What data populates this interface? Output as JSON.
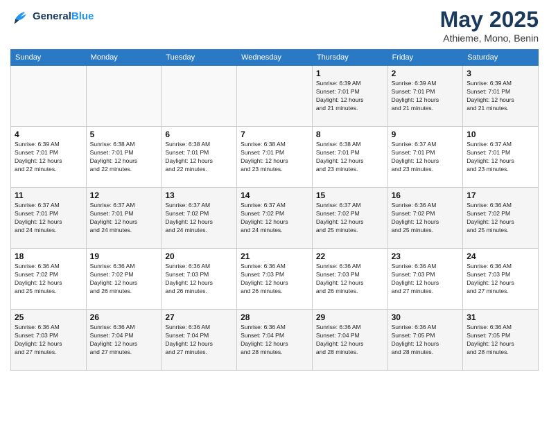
{
  "logo": {
    "line1": "General",
    "line2": "Blue"
  },
  "title": "May 2025",
  "location": "Athieme, Mono, Benin",
  "weekdays": [
    "Sunday",
    "Monday",
    "Tuesday",
    "Wednesday",
    "Thursday",
    "Friday",
    "Saturday"
  ],
  "weeks": [
    [
      {
        "day": "",
        "info": ""
      },
      {
        "day": "",
        "info": ""
      },
      {
        "day": "",
        "info": ""
      },
      {
        "day": "",
        "info": ""
      },
      {
        "day": "1",
        "info": "Sunrise: 6:39 AM\nSunset: 7:01 PM\nDaylight: 12 hours\nand 21 minutes."
      },
      {
        "day": "2",
        "info": "Sunrise: 6:39 AM\nSunset: 7:01 PM\nDaylight: 12 hours\nand 21 minutes."
      },
      {
        "day": "3",
        "info": "Sunrise: 6:39 AM\nSunset: 7:01 PM\nDaylight: 12 hours\nand 21 minutes."
      }
    ],
    [
      {
        "day": "4",
        "info": "Sunrise: 6:39 AM\nSunset: 7:01 PM\nDaylight: 12 hours\nand 22 minutes."
      },
      {
        "day": "5",
        "info": "Sunrise: 6:38 AM\nSunset: 7:01 PM\nDaylight: 12 hours\nand 22 minutes."
      },
      {
        "day": "6",
        "info": "Sunrise: 6:38 AM\nSunset: 7:01 PM\nDaylight: 12 hours\nand 22 minutes."
      },
      {
        "day": "7",
        "info": "Sunrise: 6:38 AM\nSunset: 7:01 PM\nDaylight: 12 hours\nand 23 minutes."
      },
      {
        "day": "8",
        "info": "Sunrise: 6:38 AM\nSunset: 7:01 PM\nDaylight: 12 hours\nand 23 minutes."
      },
      {
        "day": "9",
        "info": "Sunrise: 6:37 AM\nSunset: 7:01 PM\nDaylight: 12 hours\nand 23 minutes."
      },
      {
        "day": "10",
        "info": "Sunrise: 6:37 AM\nSunset: 7:01 PM\nDaylight: 12 hours\nand 23 minutes."
      }
    ],
    [
      {
        "day": "11",
        "info": "Sunrise: 6:37 AM\nSunset: 7:01 PM\nDaylight: 12 hours\nand 24 minutes."
      },
      {
        "day": "12",
        "info": "Sunrise: 6:37 AM\nSunset: 7:01 PM\nDaylight: 12 hours\nand 24 minutes."
      },
      {
        "day": "13",
        "info": "Sunrise: 6:37 AM\nSunset: 7:02 PM\nDaylight: 12 hours\nand 24 minutes."
      },
      {
        "day": "14",
        "info": "Sunrise: 6:37 AM\nSunset: 7:02 PM\nDaylight: 12 hours\nand 24 minutes."
      },
      {
        "day": "15",
        "info": "Sunrise: 6:37 AM\nSunset: 7:02 PM\nDaylight: 12 hours\nand 25 minutes."
      },
      {
        "day": "16",
        "info": "Sunrise: 6:36 AM\nSunset: 7:02 PM\nDaylight: 12 hours\nand 25 minutes."
      },
      {
        "day": "17",
        "info": "Sunrise: 6:36 AM\nSunset: 7:02 PM\nDaylight: 12 hours\nand 25 minutes."
      }
    ],
    [
      {
        "day": "18",
        "info": "Sunrise: 6:36 AM\nSunset: 7:02 PM\nDaylight: 12 hours\nand 25 minutes."
      },
      {
        "day": "19",
        "info": "Sunrise: 6:36 AM\nSunset: 7:02 PM\nDaylight: 12 hours\nand 26 minutes."
      },
      {
        "day": "20",
        "info": "Sunrise: 6:36 AM\nSunset: 7:03 PM\nDaylight: 12 hours\nand 26 minutes."
      },
      {
        "day": "21",
        "info": "Sunrise: 6:36 AM\nSunset: 7:03 PM\nDaylight: 12 hours\nand 26 minutes."
      },
      {
        "day": "22",
        "info": "Sunrise: 6:36 AM\nSunset: 7:03 PM\nDaylight: 12 hours\nand 26 minutes."
      },
      {
        "day": "23",
        "info": "Sunrise: 6:36 AM\nSunset: 7:03 PM\nDaylight: 12 hours\nand 27 minutes."
      },
      {
        "day": "24",
        "info": "Sunrise: 6:36 AM\nSunset: 7:03 PM\nDaylight: 12 hours\nand 27 minutes."
      }
    ],
    [
      {
        "day": "25",
        "info": "Sunrise: 6:36 AM\nSunset: 7:03 PM\nDaylight: 12 hours\nand 27 minutes."
      },
      {
        "day": "26",
        "info": "Sunrise: 6:36 AM\nSunset: 7:04 PM\nDaylight: 12 hours\nand 27 minutes."
      },
      {
        "day": "27",
        "info": "Sunrise: 6:36 AM\nSunset: 7:04 PM\nDaylight: 12 hours\nand 27 minutes."
      },
      {
        "day": "28",
        "info": "Sunrise: 6:36 AM\nSunset: 7:04 PM\nDaylight: 12 hours\nand 28 minutes."
      },
      {
        "day": "29",
        "info": "Sunrise: 6:36 AM\nSunset: 7:04 PM\nDaylight: 12 hours\nand 28 minutes."
      },
      {
        "day": "30",
        "info": "Sunrise: 6:36 AM\nSunset: 7:05 PM\nDaylight: 12 hours\nand 28 minutes."
      },
      {
        "day": "31",
        "info": "Sunrise: 6:36 AM\nSunset: 7:05 PM\nDaylight: 12 hours\nand 28 minutes."
      }
    ]
  ]
}
